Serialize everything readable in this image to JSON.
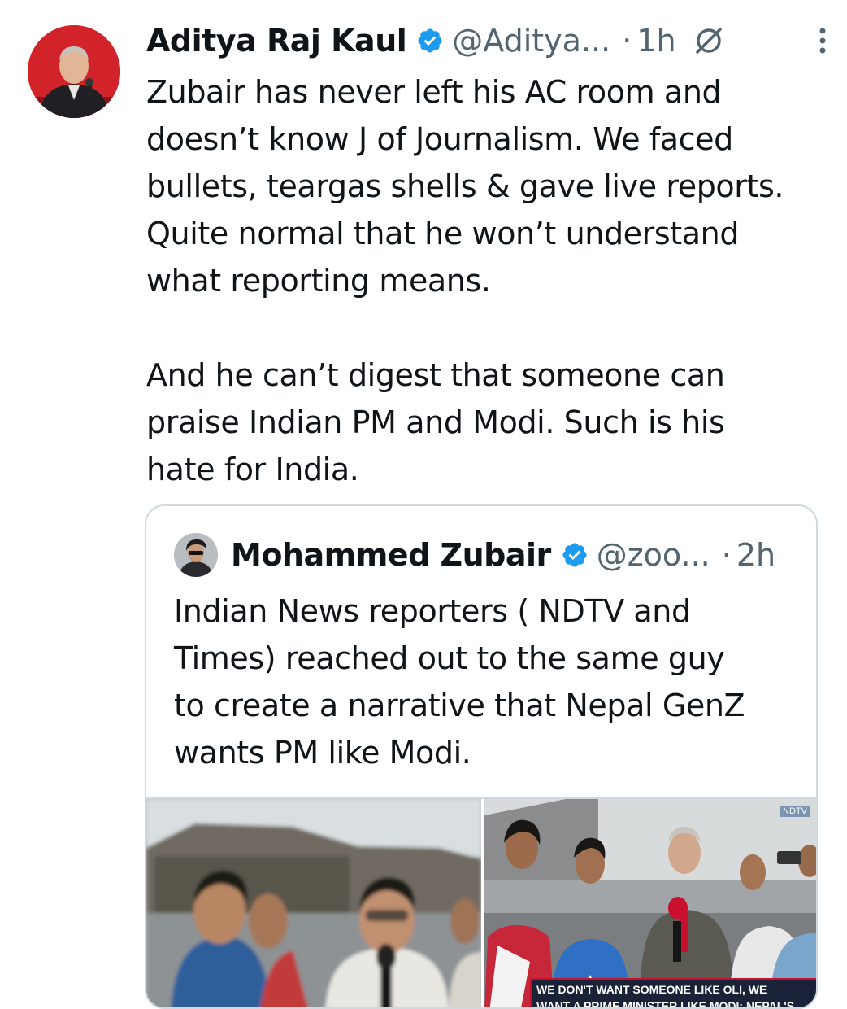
{
  "tweet": {
    "author_name": "Aditya Raj Kaul",
    "handle": "@Aditya...",
    "separator": "·",
    "time": "1h",
    "text": "Zubair has never left his AC room and\ndoesn’t know J of Journalism. We faced\nbullets, teargas shells & gave live reports.\nQuite normal that he won’t understand\nwhat reporting means.\n\nAnd he can’t digest that someone can\npraise Indian PM and Modi. Such is his\nhate for India."
  },
  "quote": {
    "author_name": "Mohammed Zubair",
    "handle": "@zoo...",
    "separator": "·",
    "time": "2h",
    "text": "Indian News reporters ( NDTV and\nTimes) reached out to the same guy\nto create a narrative that Nepal GenZ\nwants PM like Modi.",
    "media": {
      "caption": "WE DON'T WANT SOMEONE LIKE OLI, WE\nWANT A PRIME MINISTER LIKE MODI: NEPAL'S YOUTH",
      "channel_mark": "NDTV"
    }
  },
  "icons": {
    "verified": "verified-badge-icon",
    "grok": "grok-icon",
    "more": "more-vertical-icon"
  },
  "colors": {
    "verified_blue": "#1d9bf0",
    "secondary_text": "#536471",
    "border": "#cfd9de"
  }
}
